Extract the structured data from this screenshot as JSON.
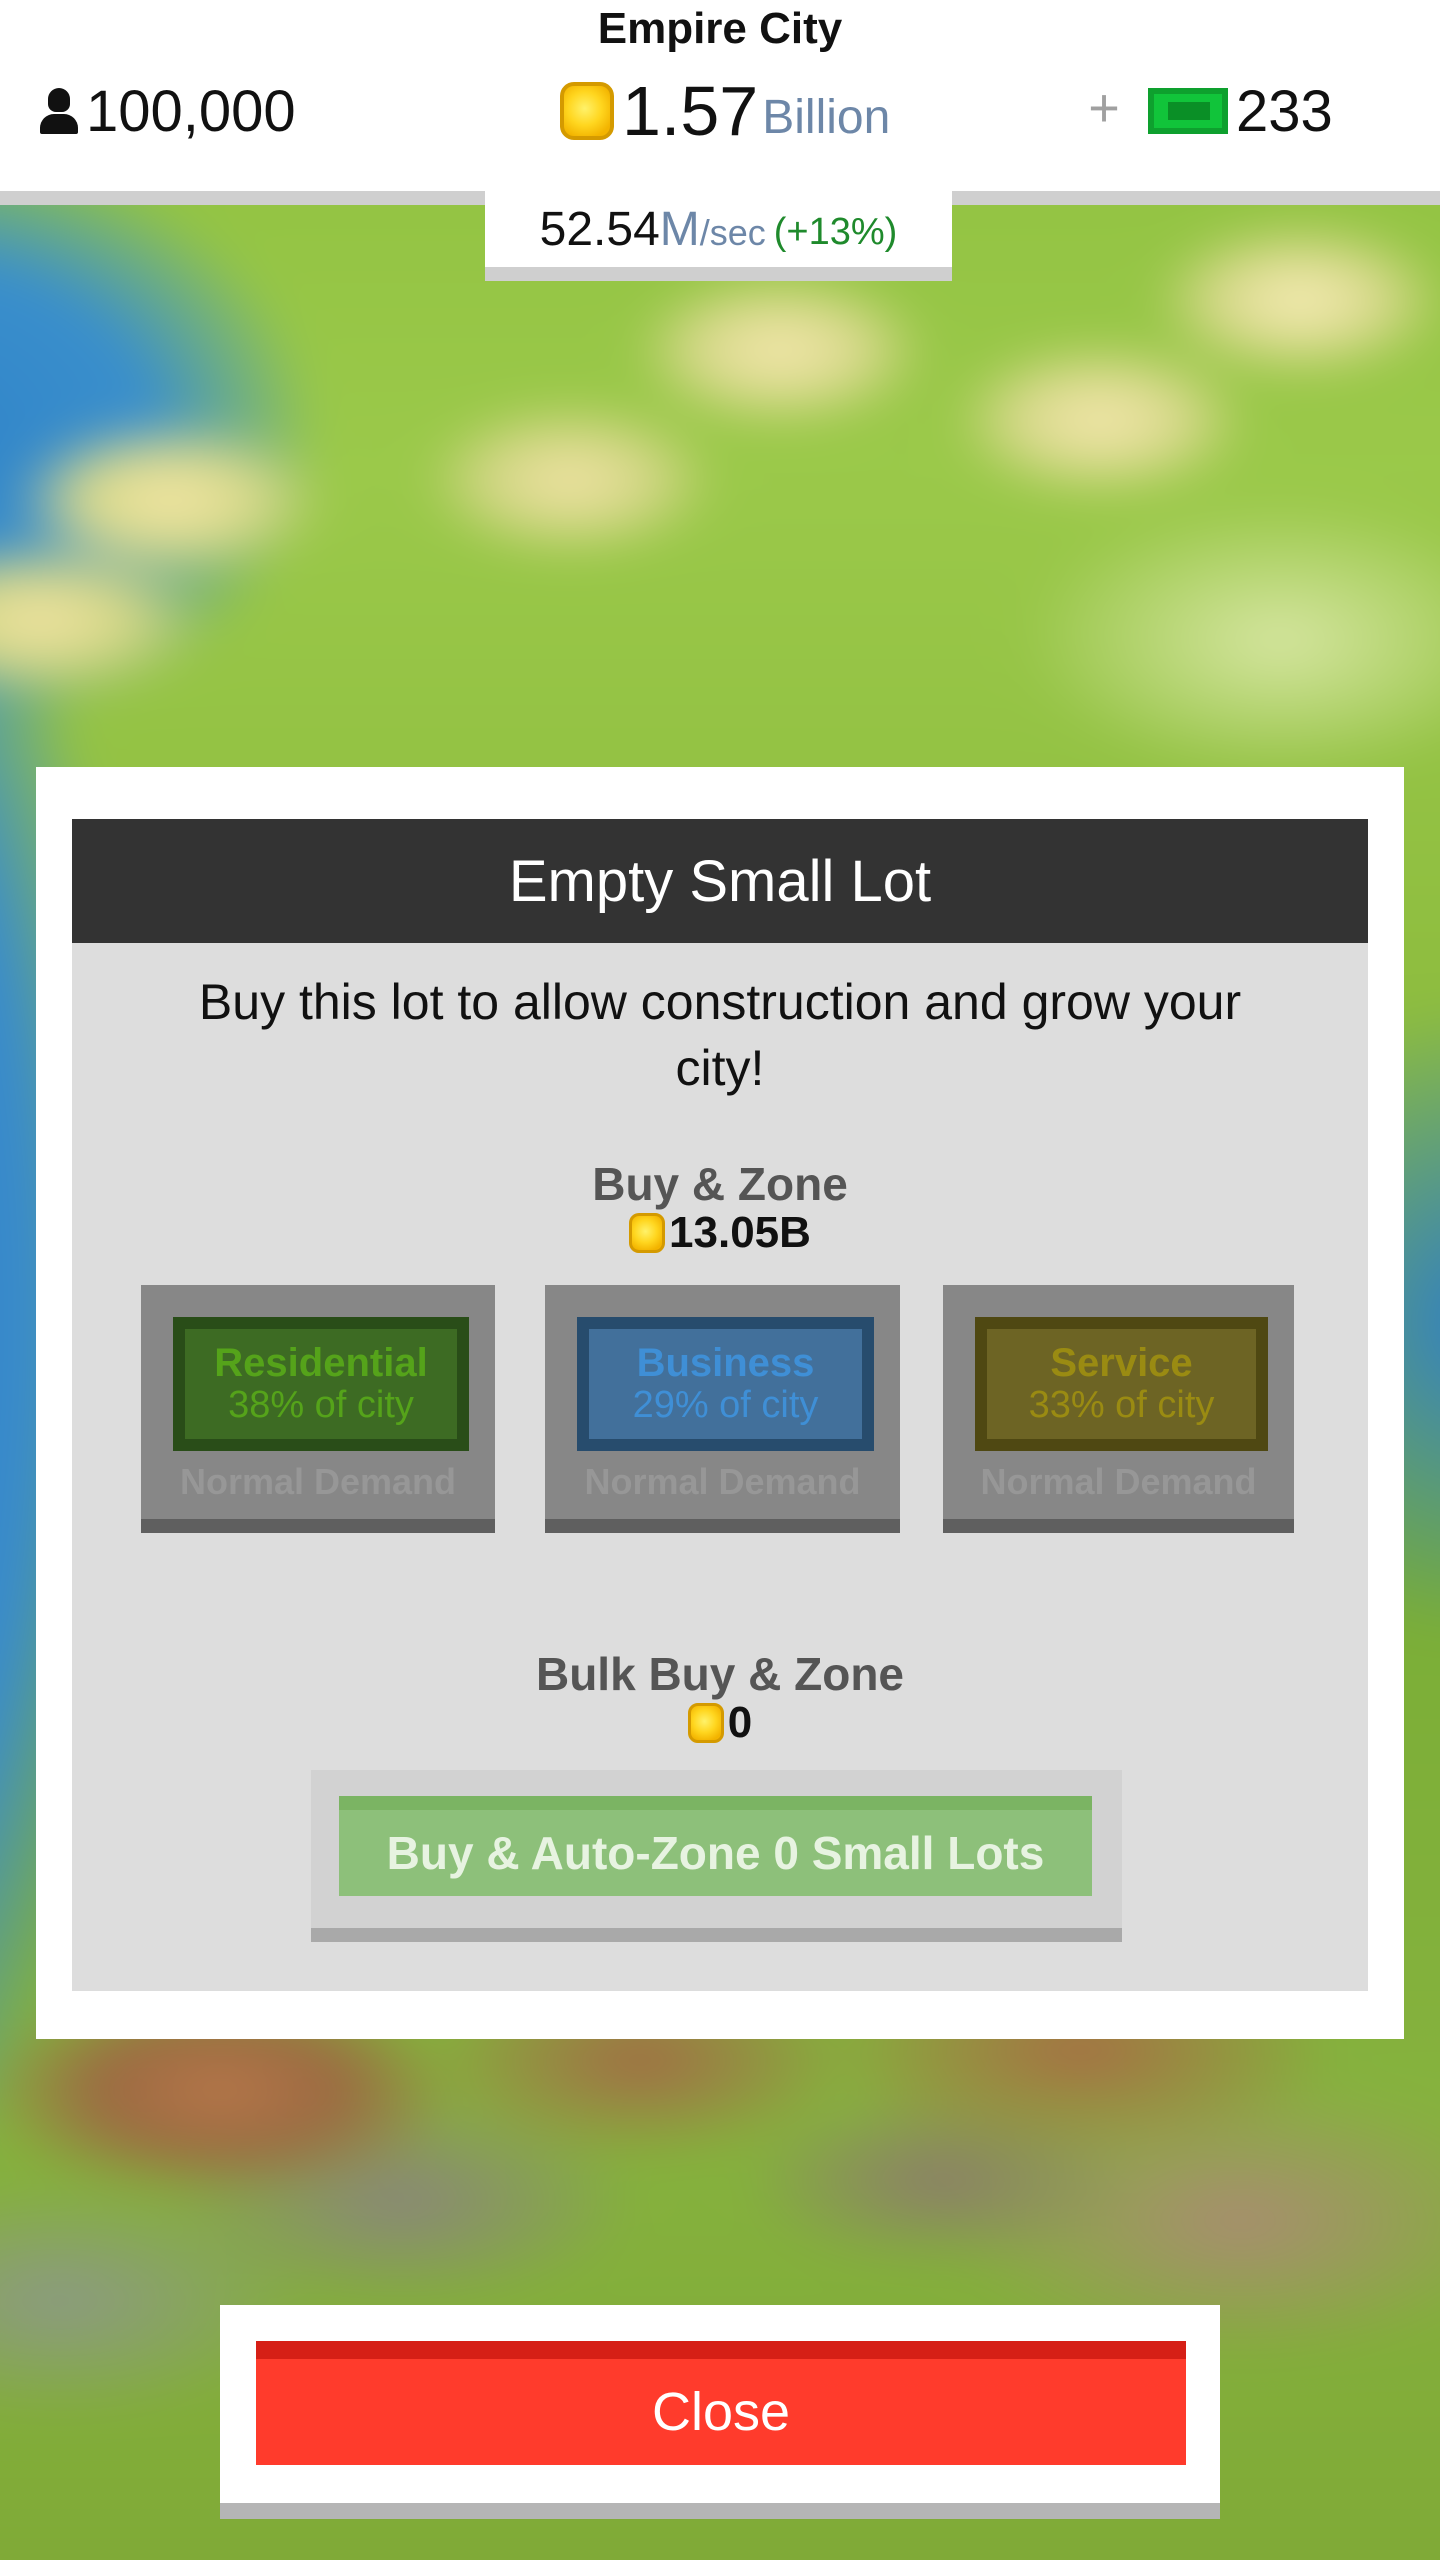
{
  "header": {
    "city_name": "Empire City",
    "population": "100,000",
    "money_value": "1.57",
    "money_unit": "Billion",
    "plus_label": "+",
    "cash_value": "233",
    "income_value": "52.54",
    "income_unit": "M",
    "income_suffix": "/sec",
    "income_bonus": "(+13%)"
  },
  "dialog": {
    "title": "Empty Small Lot",
    "description": "Buy this lot to allow construction and grow your city!",
    "buy_zone_label": "Buy & Zone",
    "buy_zone_price": "13.05B",
    "zones": [
      {
        "name": "Residential",
        "share": "38% of city",
        "demand": "Normal Demand",
        "color": "#55a31a"
      },
      {
        "name": "Business",
        "share": "29% of city",
        "demand": "Normal Demand",
        "color": "#3f8fd6"
      },
      {
        "name": "Service",
        "share": "33% of city",
        "demand": "Normal Demand",
        "color": "#9a8b12"
      }
    ],
    "bulk_label": "Bulk Buy & Zone",
    "bulk_price": "0",
    "bulk_button": "Buy & Auto-Zone 0 Small Lots"
  },
  "close_label": "Close",
  "icons": {
    "population": "person-icon",
    "money": "coin-icon",
    "cash": "cash-icon"
  }
}
